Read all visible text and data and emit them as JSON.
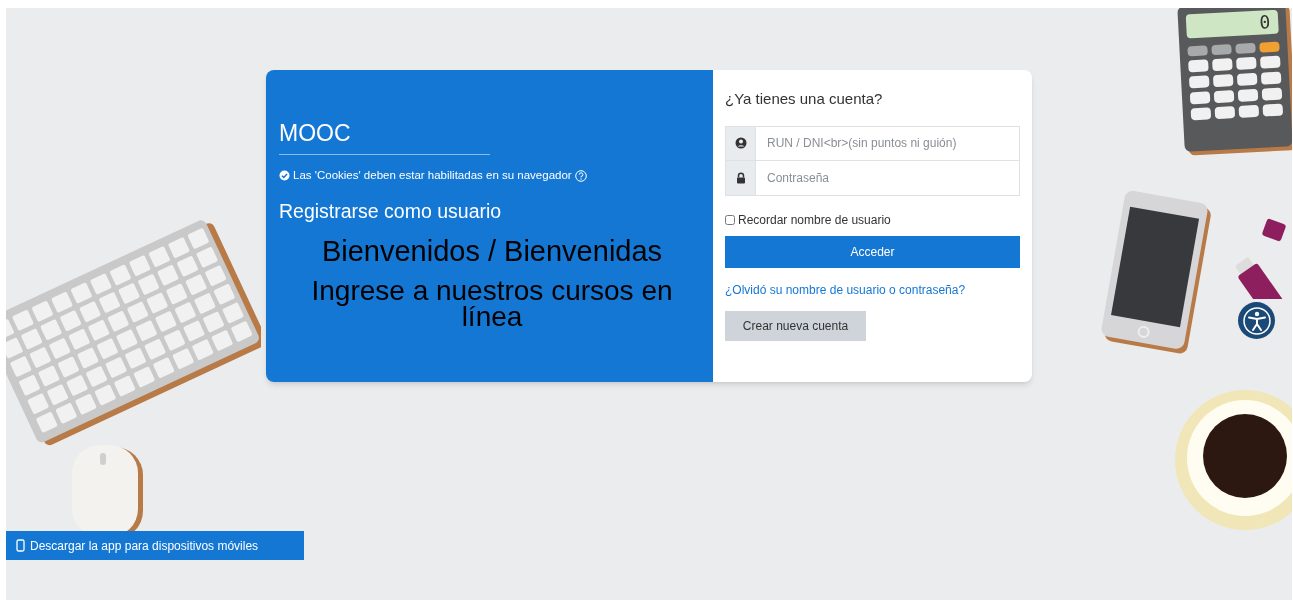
{
  "brand": {
    "title": "MOOC",
    "cookies_notice": "Las 'Cookies' deben estar habilitadas en su navegador",
    "signup_link": "Registrarse como usuario",
    "welcome": "Bienvenidos / Bienvenidas",
    "tagline": "Ingrese a nuestros cursos en línea"
  },
  "login": {
    "heading": "¿Ya tienes una cuenta?",
    "fields": [
      {
        "kind": "user",
        "placeholder": "RUN / DNI<br>(sin puntos ni guión)"
      },
      {
        "kind": "password",
        "placeholder": "Contraseña"
      }
    ],
    "remember": {
      "label": "Recordar nombre de usuario",
      "checked": false
    },
    "submit": "Acceder",
    "forgot_link": "¿Olvidó su nombre de usuario o contraseña?",
    "create_account": "Crear nueva cuenta"
  },
  "calculator_display": "0",
  "app_download": "Descargar la app para dispositivos móviles"
}
